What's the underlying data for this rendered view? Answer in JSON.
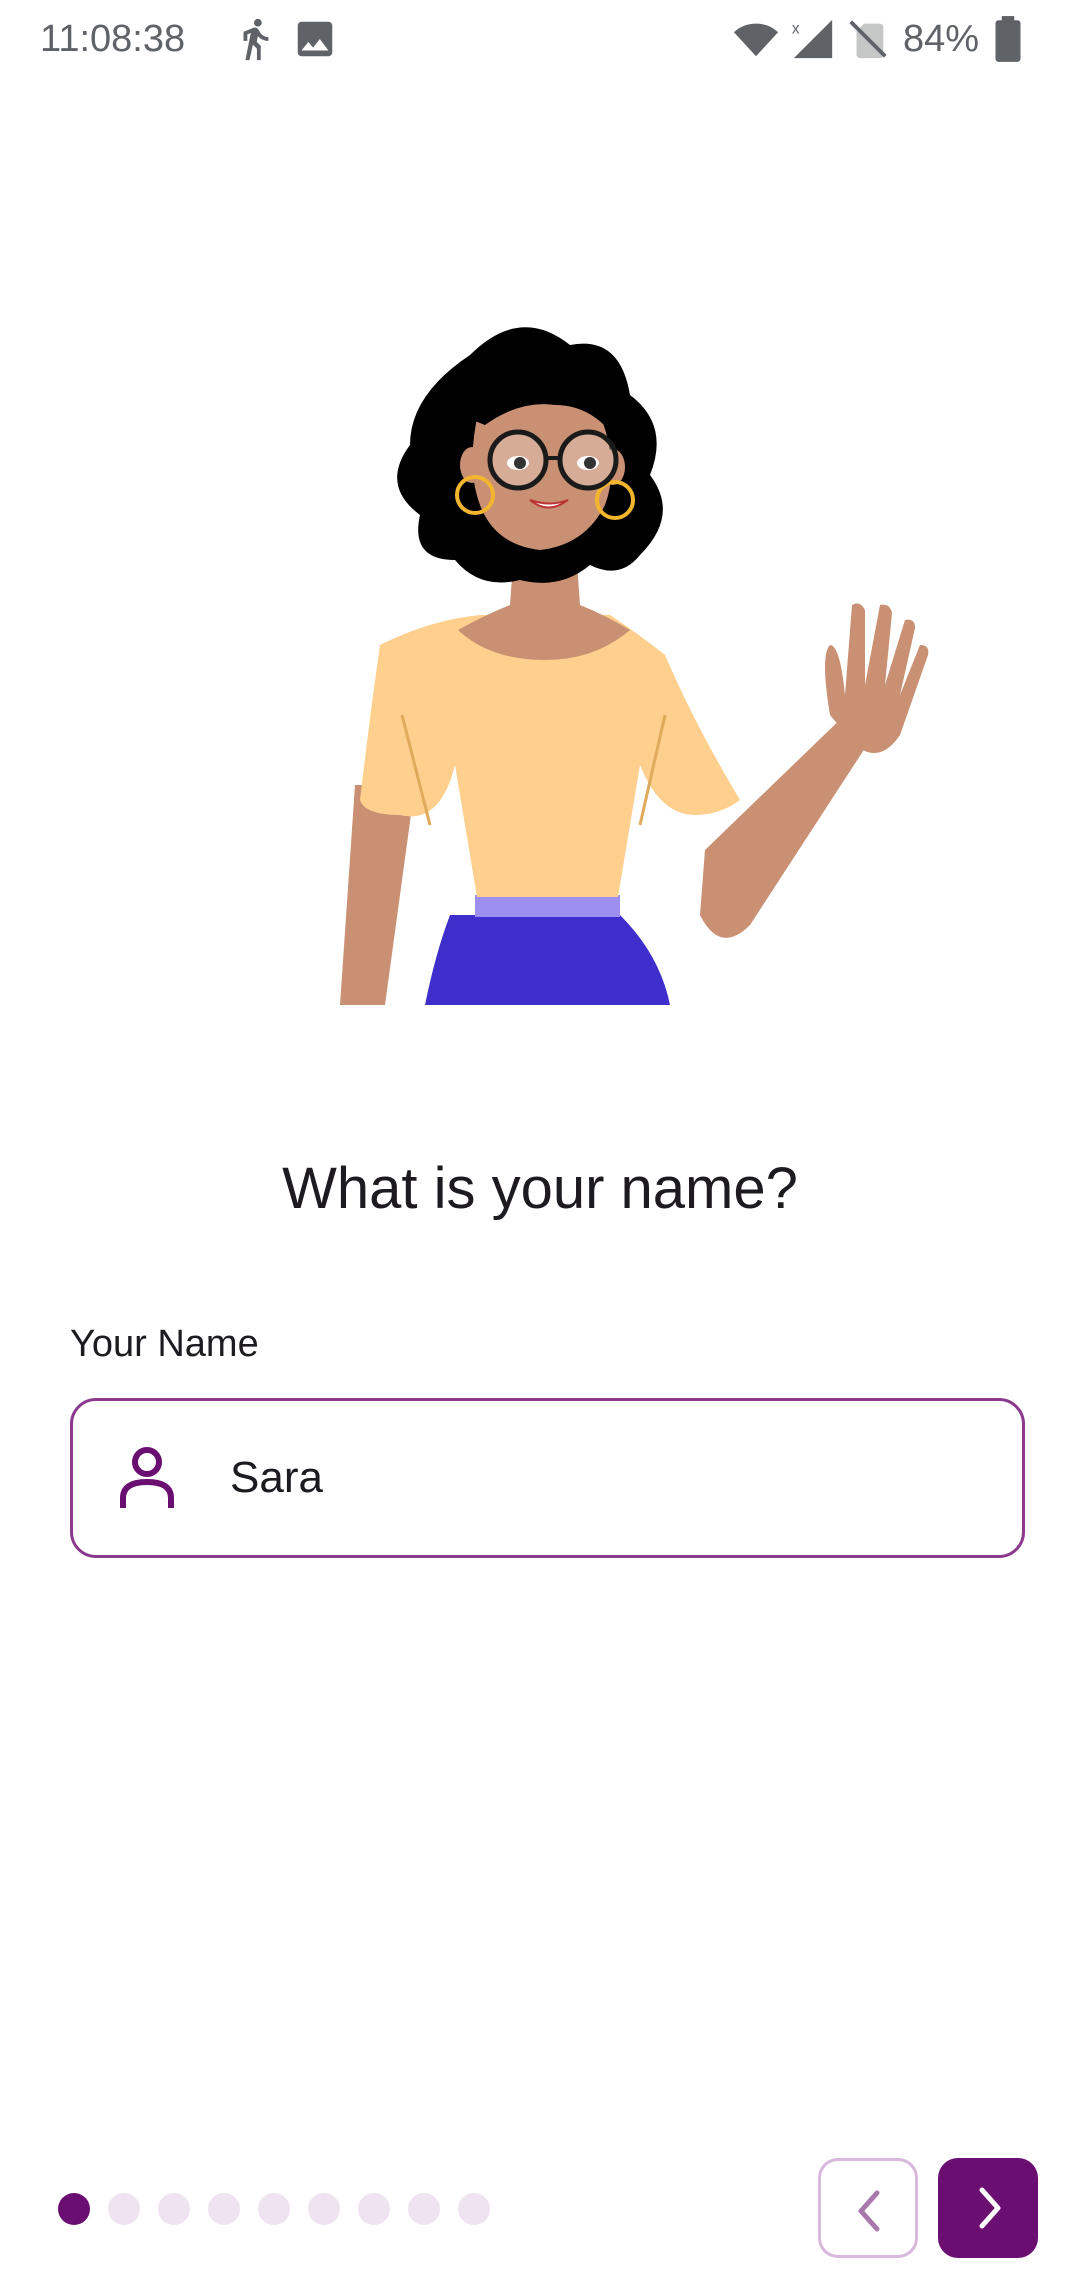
{
  "status_bar": {
    "time": "11:08:38",
    "battery": "84%",
    "icons": [
      "walking-icon",
      "image-icon",
      "wifi-icon",
      "signal-icon",
      "no-sim-icon",
      "battery-icon"
    ]
  },
  "onboarding": {
    "title": "What is your name?",
    "field_label": "Your Name",
    "field_value": "Sara",
    "field_icon": "person-icon",
    "page_indicator": {
      "total": 9,
      "current": 1
    },
    "prev_icon": "chevron-left-icon",
    "next_icon": "chevron-right-icon"
  },
  "colors": {
    "accent": "#6a0e72",
    "field_border": "#8b3a8e",
    "dot_inactive": "#efe3f1",
    "prev_border": "#d9b8dd"
  }
}
